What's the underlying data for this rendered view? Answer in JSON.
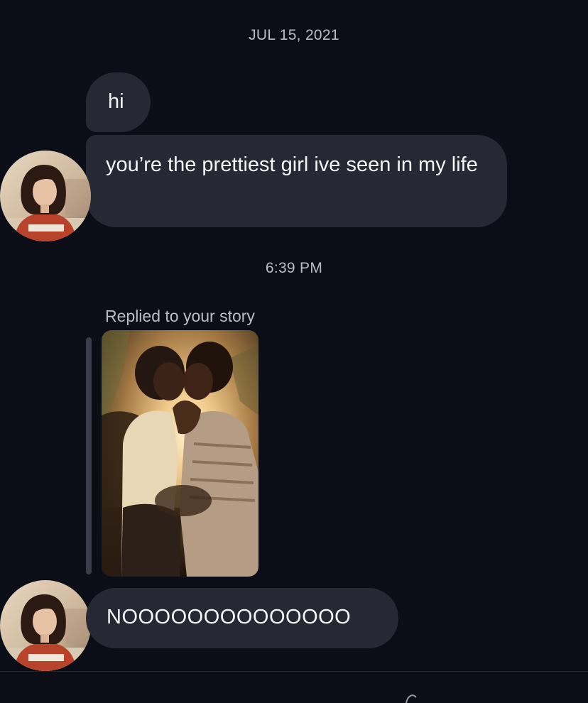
{
  "conversation": {
    "date_header": "JUL 15, 2021",
    "messages": [
      {
        "text": "hi"
      },
      {
        "text": "you’re the prettiest girl ive seen in my life"
      }
    ],
    "time_header": "6:39 PM",
    "story_reply": {
      "label": "Replied to your story",
      "reply_text": "NOOOOOOOOOOOOOO"
    }
  },
  "colors": {
    "background": "#0b0d17",
    "bubble": "#262933",
    "meta_text": "#b9bcc6",
    "reply_bar": "#393d49"
  },
  "icons": [
    "avatar",
    "story-thumbnail"
  ]
}
